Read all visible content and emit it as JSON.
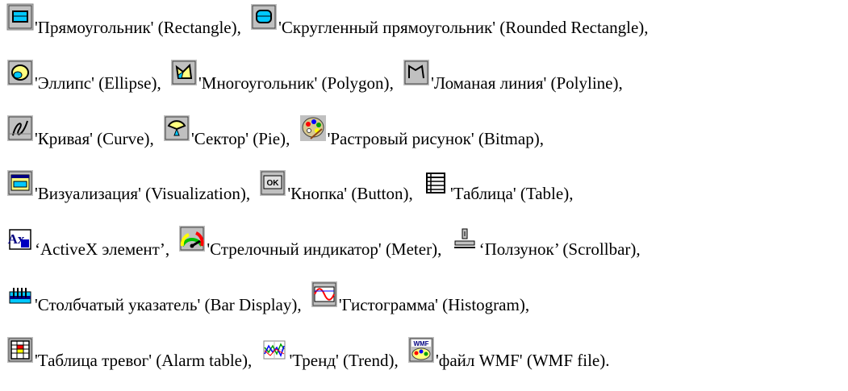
{
  "lines": [
    {
      "items": [
        {
          "icon": "rectangle-icon",
          "label": "'Прямоугольник' (Rectangle)",
          "sep": ","
        },
        {
          "icon": "rounded-rectangle-icon",
          "label": "'Скругленный прямоугольник' (Rounded Rectangle)",
          "sep": ","
        }
      ]
    },
    {
      "items": [
        {
          "icon": "ellipse-icon",
          "label": "'Эллипс' (Ellipse)",
          "sep": ","
        },
        {
          "icon": "polygon-icon",
          "label": "'Многоугольник' (Polygon)",
          "sep": ","
        },
        {
          "icon": "polyline-icon",
          "label": "'Ломаная линия' (Polyline)",
          "sep": ","
        }
      ]
    },
    {
      "items": [
        {
          "icon": "curve-icon",
          "label": "'Кривая' (Curve)",
          "sep": ","
        },
        {
          "icon": "pie-icon",
          "label": "'Сектор' (Pie)",
          "sep": ","
        },
        {
          "icon": "bitmap-icon",
          "label": "'Растровый рисунок' (Bitmap)",
          "sep": ","
        }
      ]
    },
    {
      "items": [
        {
          "icon": "visualization-icon",
          "label": "'Визуализация' (Visualization)",
          "sep": ","
        },
        {
          "icon": "button-icon",
          "label": "'Кнопка' (Button)",
          "sep": ","
        },
        {
          "icon": "table-icon",
          "label": "'Таблица' (Table)",
          "sep": ","
        }
      ]
    },
    {
      "items": [
        {
          "icon": "activex-icon",
          "label": "‘ActiveX элемент’",
          "sep": ","
        },
        {
          "icon": "meter-icon",
          "label": "'Стрелочный индикатор' (Meter)",
          "sep": ","
        },
        {
          "icon": "scrollbar-icon",
          "label": "‘Ползунок’ (Scrollbar)",
          "sep": ","
        }
      ]
    },
    {
      "items": [
        {
          "icon": "bar-display-icon",
          "label": "'Столбчатый указатель' (Bar Display)",
          "sep": ","
        },
        {
          "icon": "histogram-icon",
          "label": "'Гистограмма' (Histogram)",
          "sep": ","
        }
      ]
    },
    {
      "items": [
        {
          "icon": "alarm-table-icon",
          "label": "'Таблица тревог' (Alarm table)",
          "sep": ","
        },
        {
          "icon": "trend-icon",
          "label": "'Тренд' (Trend)",
          "sep": ","
        },
        {
          "icon": "wmf-file-icon",
          "label": "'файл WMF' (WMF file)",
          "sep": "."
        }
      ]
    }
  ],
  "button_icon_text": "OK",
  "wmf_icon_text": "WMF",
  "activex_icon_text": "Ax"
}
